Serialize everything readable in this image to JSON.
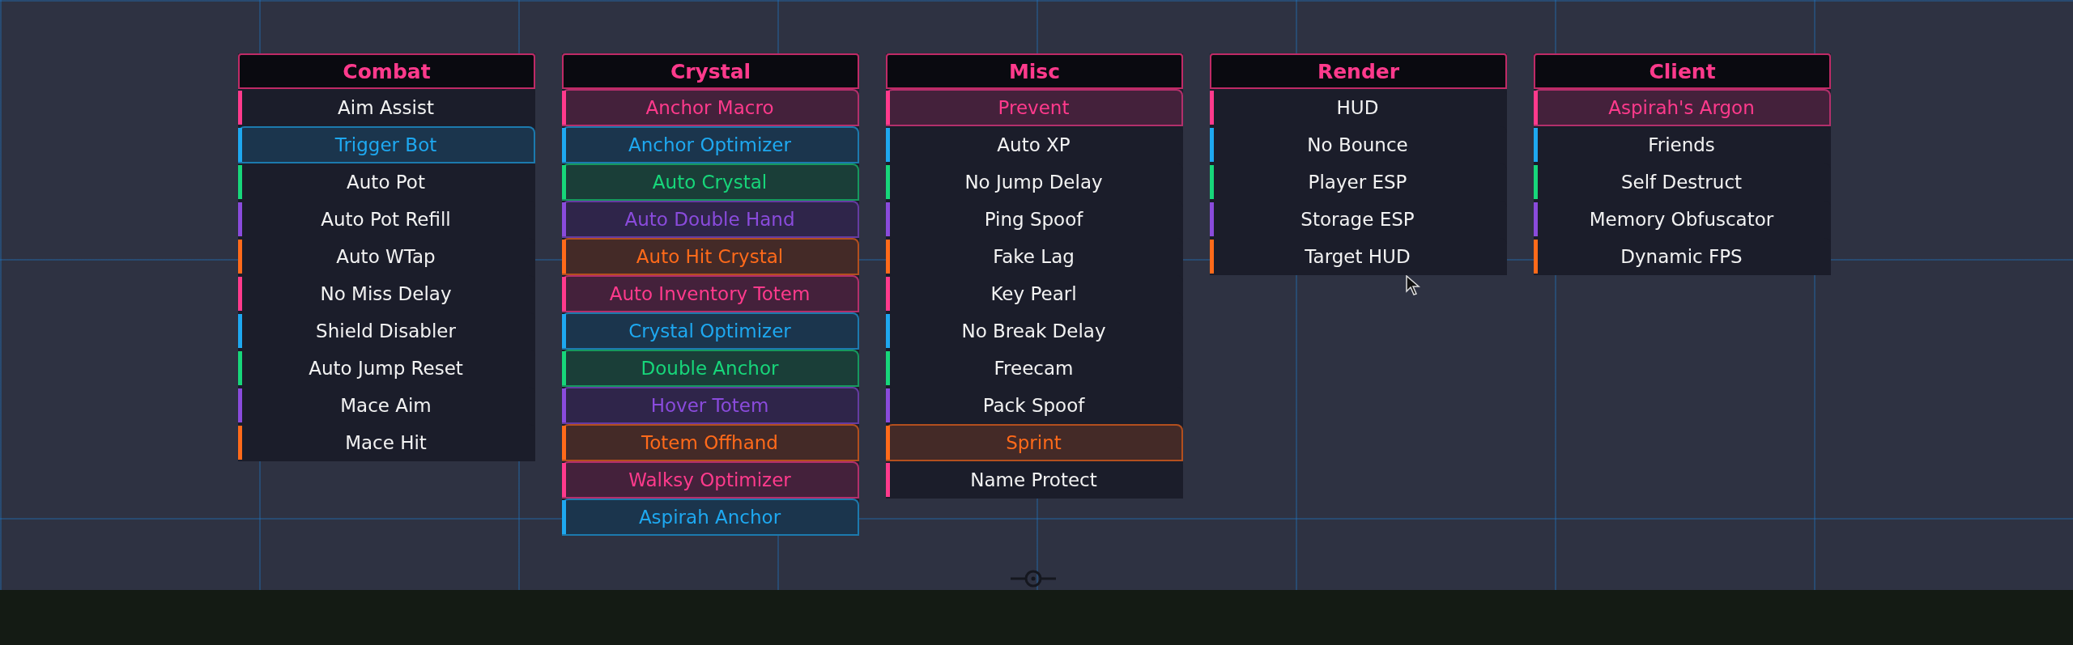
{
  "panels": [
    {
      "title": "Combat",
      "items": [
        {
          "label": "Aim Assist",
          "enabled": false,
          "color": "#ff3a8c"
        },
        {
          "label": "Trigger Bot",
          "enabled": true,
          "color": "#1ea8f0"
        },
        {
          "label": "Auto Pot",
          "enabled": false,
          "color": "#17d67a"
        },
        {
          "label": "Auto Pot Refill",
          "enabled": false,
          "color": "#8a4bdc"
        },
        {
          "label": "Auto WTap",
          "enabled": false,
          "color": "#ff6a1a"
        },
        {
          "label": "No Miss Delay",
          "enabled": false,
          "color": "#ff3a8c"
        },
        {
          "label": "Shield Disabler",
          "enabled": false,
          "color": "#1ea8f0"
        },
        {
          "label": "Auto Jump Reset",
          "enabled": false,
          "color": "#17d67a"
        },
        {
          "label": "Mace Aim",
          "enabled": false,
          "color": "#8a4bdc"
        },
        {
          "label": "Mace Hit",
          "enabled": false,
          "color": "#ff6a1a"
        }
      ]
    },
    {
      "title": "Crystal",
      "items": [
        {
          "label": "Anchor Macro",
          "enabled": true,
          "color": "#ff3a8c"
        },
        {
          "label": "Anchor Optimizer",
          "enabled": true,
          "color": "#1ea8f0"
        },
        {
          "label": "Auto Crystal",
          "enabled": true,
          "color": "#17d67a"
        },
        {
          "label": "Auto Double Hand",
          "enabled": true,
          "color": "#8a4bdc"
        },
        {
          "label": "Auto Hit Crystal",
          "enabled": true,
          "color": "#ff6a1a"
        },
        {
          "label": "Auto Inventory Totem",
          "enabled": true,
          "color": "#ff3a8c"
        },
        {
          "label": "Crystal Optimizer",
          "enabled": true,
          "color": "#1ea8f0"
        },
        {
          "label": "Double Anchor",
          "enabled": true,
          "color": "#17d67a"
        },
        {
          "label": "Hover Totem",
          "enabled": true,
          "color": "#8a4bdc"
        },
        {
          "label": "Totem Offhand",
          "enabled": true,
          "color": "#ff6a1a"
        },
        {
          "label": "Walksy Optimizer",
          "enabled": true,
          "color": "#ff3a8c"
        },
        {
          "label": "Aspirah Anchor",
          "enabled": true,
          "color": "#1ea8f0"
        }
      ]
    },
    {
      "title": "Misc",
      "items": [
        {
          "label": "Prevent",
          "enabled": true,
          "color": "#ff3a8c"
        },
        {
          "label": "Auto XP",
          "enabled": false,
          "color": "#1ea8f0"
        },
        {
          "label": "No Jump Delay",
          "enabled": false,
          "color": "#17d67a"
        },
        {
          "label": "Ping Spoof",
          "enabled": false,
          "color": "#8a4bdc"
        },
        {
          "label": "Fake Lag",
          "enabled": false,
          "color": "#ff6a1a"
        },
        {
          "label": "Key Pearl",
          "enabled": false,
          "color": "#ff3a8c"
        },
        {
          "label": "No Break Delay",
          "enabled": false,
          "color": "#1ea8f0"
        },
        {
          "label": "Freecam",
          "enabled": false,
          "color": "#17d67a"
        },
        {
          "label": "Pack Spoof",
          "enabled": false,
          "color": "#8a4bdc"
        },
        {
          "label": "Sprint",
          "enabled": true,
          "color": "#ff6a1a"
        },
        {
          "label": "Name Protect",
          "enabled": false,
          "color": "#ff3a8c"
        }
      ]
    },
    {
      "title": "Render",
      "items": [
        {
          "label": "HUD",
          "enabled": false,
          "color": "#ff3a8c"
        },
        {
          "label": "No Bounce",
          "enabled": false,
          "color": "#1ea8f0"
        },
        {
          "label": "Player ESP",
          "enabled": false,
          "color": "#17d67a"
        },
        {
          "label": "Storage ESP",
          "enabled": false,
          "color": "#8a4bdc"
        },
        {
          "label": "Target HUD",
          "enabled": false,
          "color": "#ff6a1a"
        }
      ]
    },
    {
      "title": "Client",
      "items": [
        {
          "label": "Aspirah's Argon",
          "enabled": true,
          "color": "#ff3a8c"
        },
        {
          "label": "Friends",
          "enabled": false,
          "color": "#1ea8f0"
        },
        {
          "label": "Self Destruct",
          "enabled": false,
          "color": "#17d67a"
        },
        {
          "label": "Memory Obfuscator",
          "enabled": false,
          "color": "#8a4bdc"
        },
        {
          "label": "Dynamic FPS",
          "enabled": false,
          "color": "#ff6a1a"
        }
      ]
    }
  ]
}
